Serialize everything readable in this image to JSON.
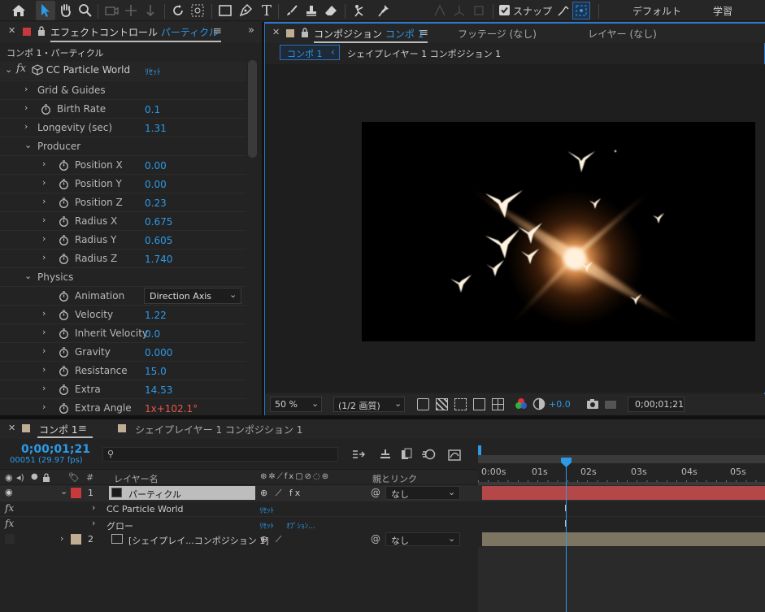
{
  "toolbar": {
    "snap_label": "スナップ",
    "workspace_default": "デフォルト",
    "workspace_learn": "学習"
  },
  "effect_panel": {
    "tab_prefix": "エフェクトコントロール",
    "tab_layer": "パーティクル",
    "breadcrumb": "コンポ 1・パーティクル",
    "effect_name": "CC Particle World",
    "reset_label": "ﾘｾｯﾄ",
    "properties": [
      {
        "label": "Grid & Guides",
        "value": ""
      },
      {
        "label": "Birth Rate",
        "value": "0.1"
      },
      {
        "label": "Longevity (sec)",
        "value": "1.31"
      },
      {
        "label": "Producer",
        "value": ""
      },
      {
        "label": "Position X",
        "value": "0.00"
      },
      {
        "label": "Position Y",
        "value": "0.00"
      },
      {
        "label": "Position Z",
        "value": "0.23"
      },
      {
        "label": "Radius X",
        "value": "0.675"
      },
      {
        "label": "Radius Y",
        "value": "0.605"
      },
      {
        "label": "Radius Z",
        "value": "1.740"
      },
      {
        "label": "Physics",
        "value": ""
      },
      {
        "label": "Animation",
        "value": "Direction Axis"
      },
      {
        "label": "Velocity",
        "value": "1.22"
      },
      {
        "label": "Inherit Velocity",
        "value": "0.0"
      },
      {
        "label": "Gravity",
        "value": "0.000"
      },
      {
        "label": "Resistance",
        "value": "15.0"
      },
      {
        "label": "Extra",
        "value": "14.53"
      },
      {
        "label": "Extra Angle",
        "value": "1x+102.1°"
      }
    ]
  },
  "comp_panel": {
    "tab_prefix": "コンポジション",
    "tab_comp": "コンポ 1",
    "footage_tab": "フッテージ (なし)",
    "layer_tab": "レイヤー (なし)",
    "nav_current": "コンポ 1",
    "nav_next": "シェイプレイヤー 1 コンポジション 1",
    "zoom": "50 %",
    "quality": "(1/2 画質)",
    "exposure": "+0.0",
    "timecode": "0;00;01;21"
  },
  "timeline": {
    "tab_comp": "コンポ 1",
    "tab_other": "シェイプレイヤー 1 コンポジション 1",
    "timecode": "0;00;01;21",
    "frame_info": "00051 (29.97 fps)",
    "col_number": "#",
    "col_layer_name": "レイヤー名",
    "col_parent": "親とリンク",
    "ruler": [
      "0:00s",
      "01s",
      "02s",
      "03s",
      "04s",
      "05s"
    ],
    "layers": [
      {
        "number": "1",
        "name": "パーティクル",
        "parent": "なし",
        "color": "#c8393b"
      },
      {
        "number": "2",
        "name": "[シェイプレイ...コンポジション 1]",
        "parent": "なし",
        "color": "#bfae94"
      }
    ],
    "effects": [
      {
        "name": "CC Particle World",
        "reset": "ﾘｾｯﾄ",
        "options": ""
      },
      {
        "name": "グロー",
        "reset": "ﾘｾｯﾄ",
        "options": "ｵﾌﾟｼｮﾝ..."
      }
    ]
  }
}
